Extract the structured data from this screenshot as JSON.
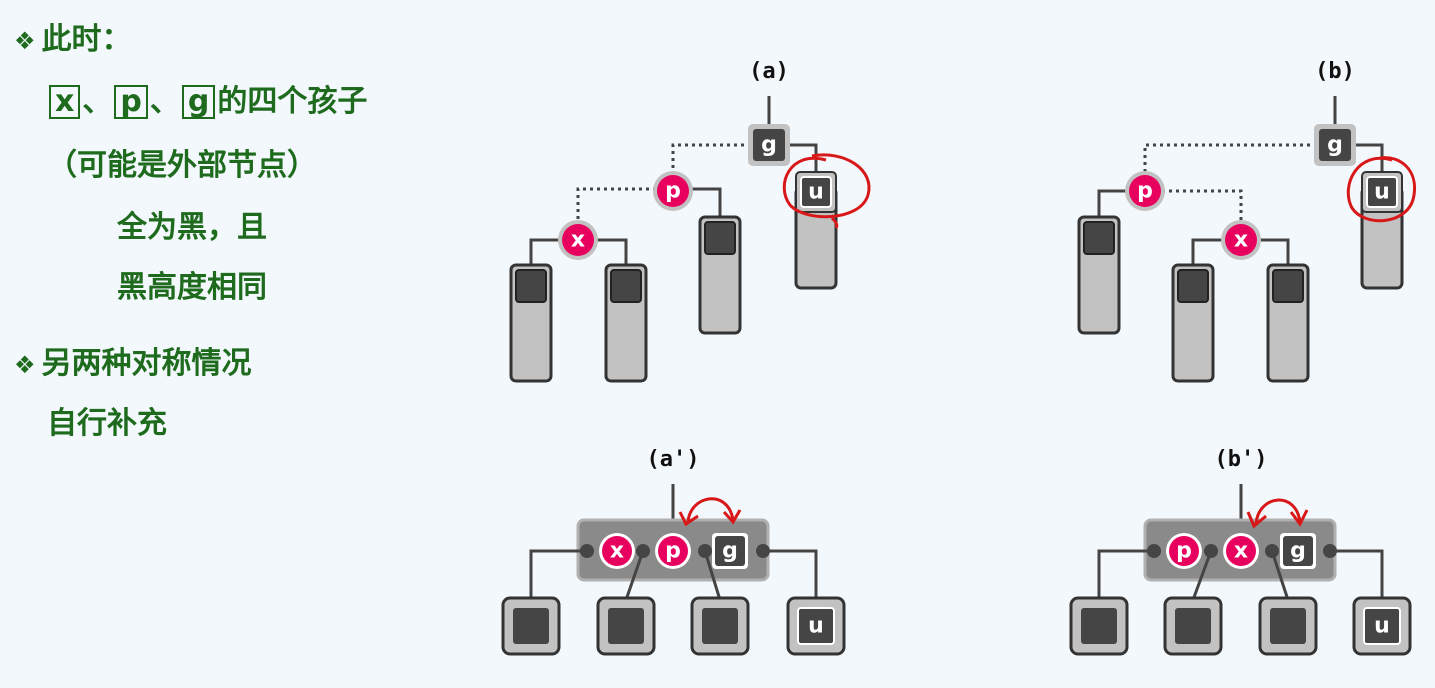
{
  "left_text": {
    "bullet1": "此时：",
    "x": "x",
    "sep1": "、",
    "p": "p",
    "sep2": "、",
    "g": "g",
    "children_suffix": "的四个孩子",
    "line2": "（可能是外部节点）",
    "line3": "全为黑，且",
    "line4": "黑高度相同",
    "bullet2": "另两种对称情况",
    "line5": "自行补充"
  },
  "diagrams": {
    "a_label": "(a)",
    "b_label": "(b)",
    "a2_label": "(a')",
    "b2_label": "(b')",
    "nodes": {
      "x": "x",
      "p": "p",
      "g": "g",
      "u": "u"
    }
  },
  "colors": {
    "red_node": "#e8005f",
    "black_node": "#454545",
    "subtree": "#c2c2c2",
    "annotation": "#d81818",
    "text_green": "#1e6b1e"
  }
}
